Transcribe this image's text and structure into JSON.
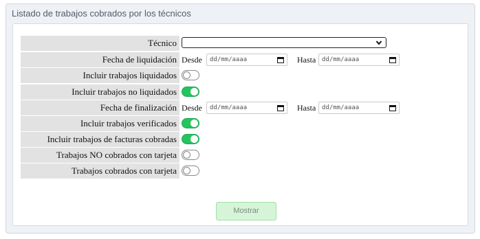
{
  "panel": {
    "title": "Listado de trabajos cobrados por los técnicos"
  },
  "form": {
    "tecnico": {
      "label": "Técnico",
      "value": ""
    },
    "fecha_liquidacion": {
      "label": "Fecha de liquidación",
      "desde_label": "Desde",
      "desde_placeholder": "dd/mm/aaaa",
      "hasta_label": "Hasta",
      "hasta_placeholder": "dd/mm/aaaa"
    },
    "incluir_liquidados": {
      "label": "Incluir trabajos liquidados",
      "checked": false
    },
    "incluir_no_liquidados": {
      "label": "Incluir trabajos no liquidados",
      "checked": true
    },
    "fecha_finalizacion": {
      "label": "Fecha de finalización",
      "desde_label": "Desde",
      "desde_placeholder": "dd/mm/aaaa",
      "hasta_label": "Hasta",
      "hasta_placeholder": "dd/mm/aaaa"
    },
    "incluir_verificados": {
      "label": "Incluir trabajos verificados",
      "checked": true
    },
    "incluir_facturas_cobradas": {
      "label": "Incluir trabajos de facturas cobradas",
      "checked": true
    },
    "no_cobrados_tarjeta": {
      "label": "Trabajos NO cobrados con tarjeta",
      "checked": false
    },
    "cobrados_tarjeta": {
      "label": "Trabajos cobrados con tarjeta",
      "checked": false
    },
    "submit_label": "Mostrar"
  },
  "colors": {
    "toggle_on": "#22c55e",
    "button_bg": "#d6f5d8"
  },
  "icons": {
    "select": "chevron-down-icon",
    "date": "calendar-icon"
  }
}
